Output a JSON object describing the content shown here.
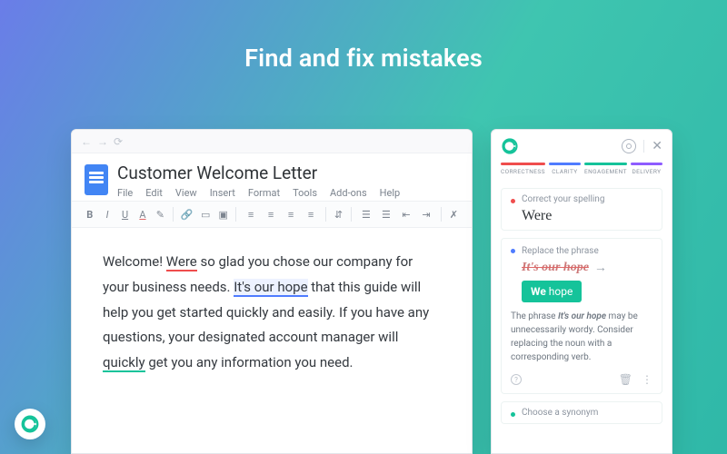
{
  "hero": {
    "title": "Find and fix mistakes"
  },
  "editor": {
    "doc_title": "Customer Welcome Letter",
    "menus": [
      "File",
      "Edit",
      "View",
      "Insert",
      "Format",
      "Tools",
      "Add-ons",
      "Help"
    ],
    "body": {
      "t1": "Welcome! ",
      "err_were": "Were",
      "t2": " so glad you chose our company for your business needs. ",
      "err_hope": "It's our hope",
      "t3": " that this guide will help you get started quickly and easily. If you have any questions, your designated account manager will ",
      "err_quickly": "quickly",
      "t4": " get you any information you need."
    }
  },
  "panel": {
    "categories": [
      "CORRECTNESS",
      "CLARITY",
      "ENGAGEMENT",
      "DELIVERY"
    ],
    "card1": {
      "title": "Correct your spelling",
      "word": "Were"
    },
    "card2": {
      "title": "Replace the phrase",
      "strike": "It's our hope",
      "chip_bold": "We",
      "chip_rest": " hope",
      "explain_pre": "The phrase ",
      "explain_em": "It's our hope",
      "explain_post": " may be unnecessarily wordy. Consider replacing the noun with a corresponding verb."
    },
    "card3": {
      "title": "Choose a synonym"
    }
  }
}
